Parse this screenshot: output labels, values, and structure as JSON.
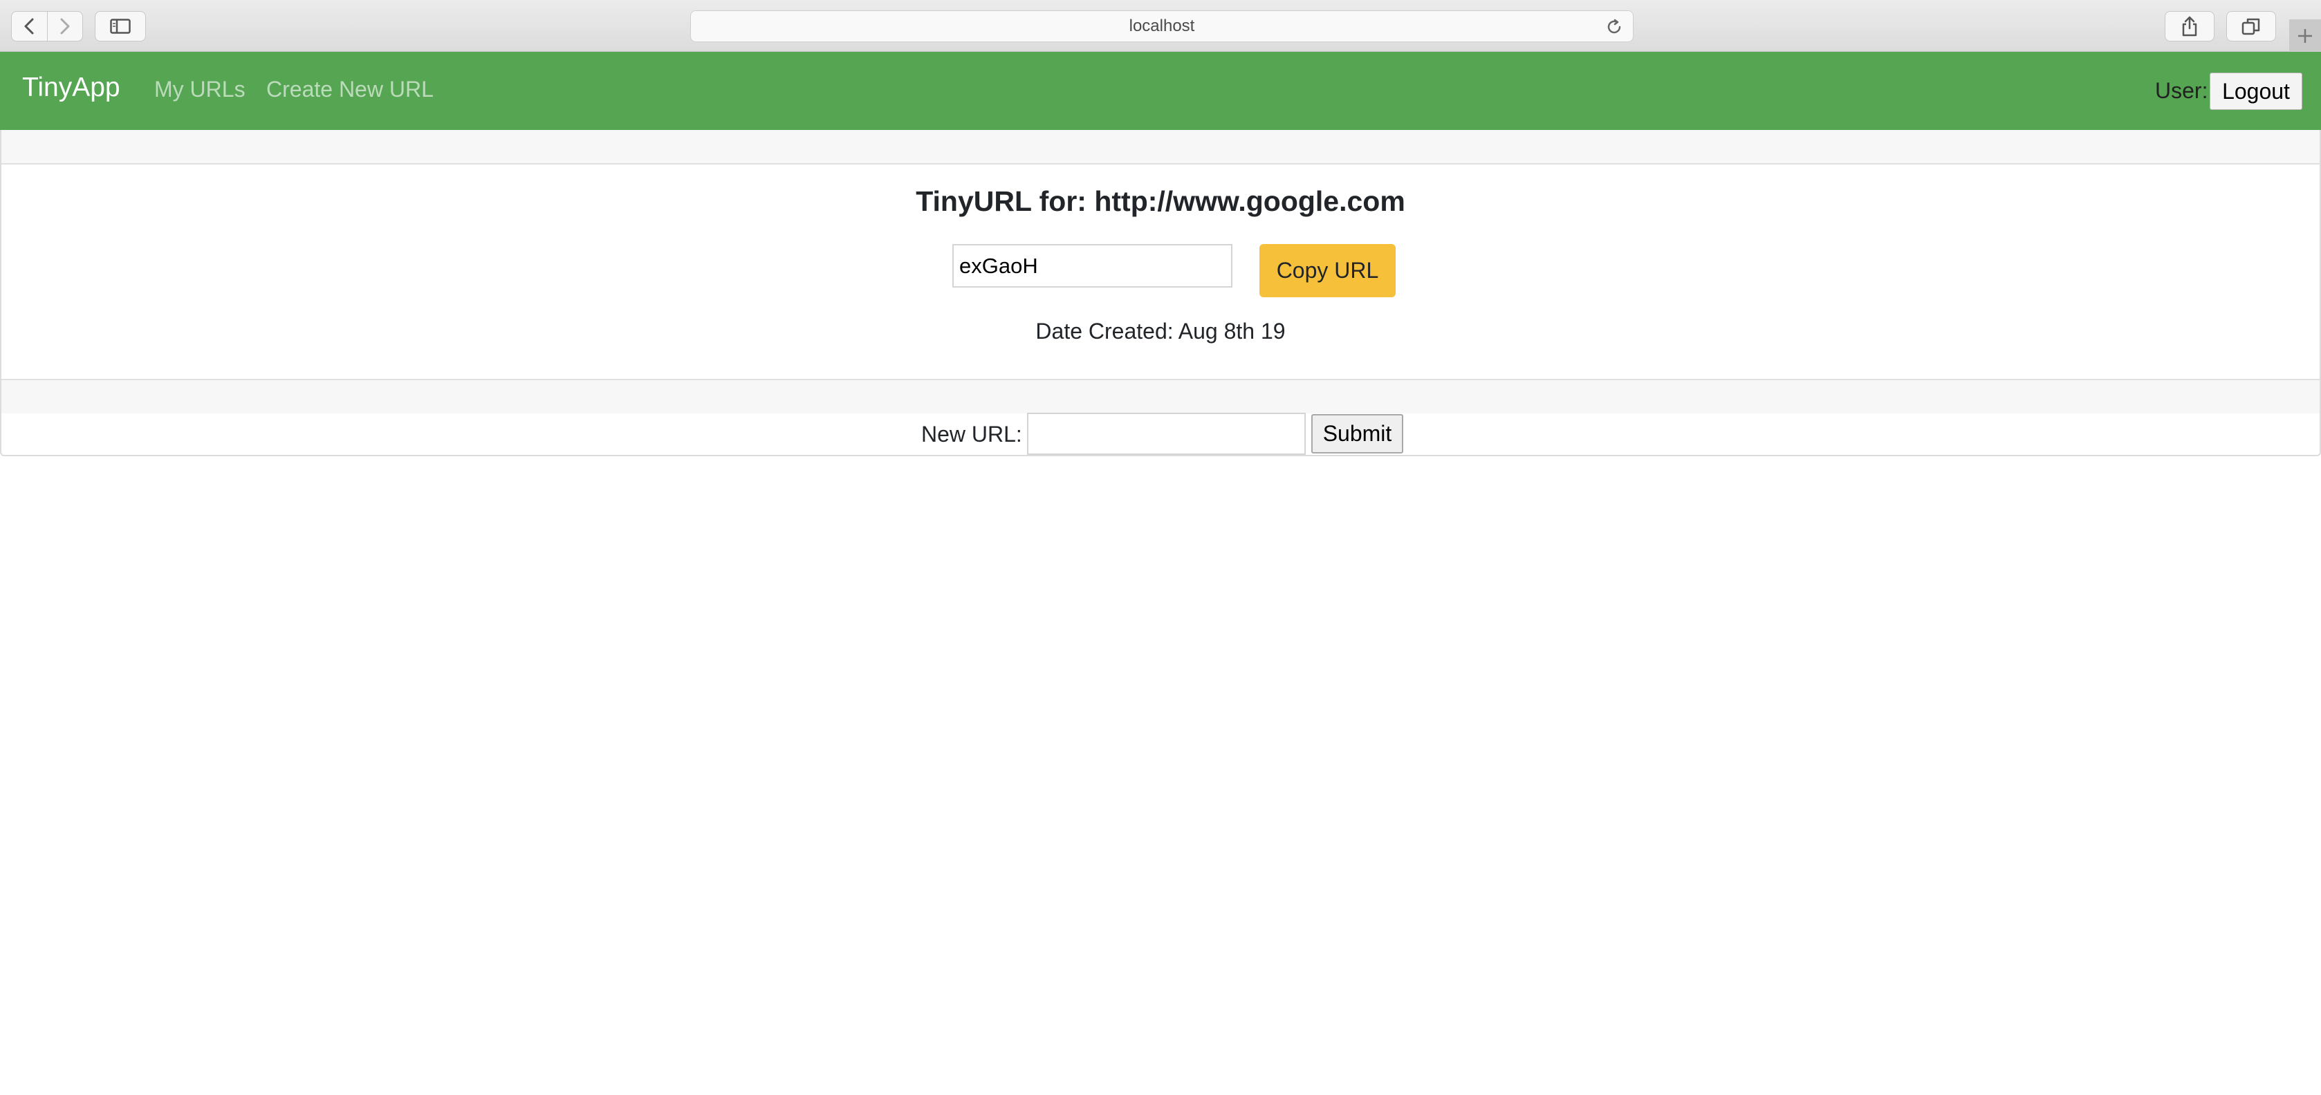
{
  "browser": {
    "address": "localhost"
  },
  "navbar": {
    "brand": "TinyApp",
    "links": [
      "My URLs",
      "Create New URL"
    ],
    "user_label": "User:",
    "logout_label": "Logout",
    "background_color": "#55a553"
  },
  "url_card": {
    "title": "TinyURL for: http://www.google.com",
    "short_code_value": "exGaoH",
    "copy_button_label": "Copy URL",
    "copy_button_color": "#f7c03b",
    "date_created": "Date Created: Aug 8th 19"
  },
  "update_form": {
    "label": "New URL:",
    "input_value": "",
    "submit_label": "Submit"
  }
}
